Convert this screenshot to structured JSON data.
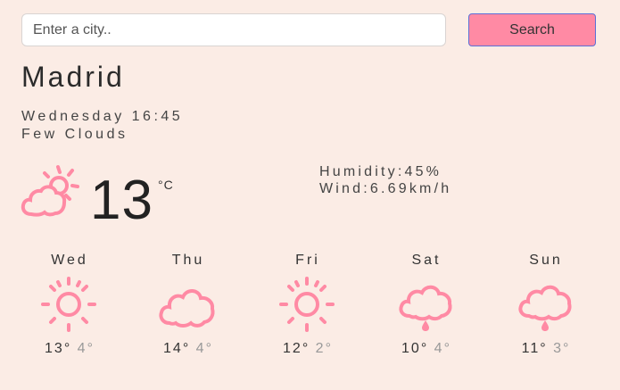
{
  "search": {
    "placeholder": "Enter a city..",
    "button_label": "Search"
  },
  "current": {
    "city": "Madrid",
    "day_time": "Wednesday 16:45",
    "condition": "Few Clouds",
    "icon": "few-clouds-icon",
    "temperature": "13",
    "unit": "°C",
    "humidity": "Humidity:45%",
    "wind": "Wind:6.69km/h"
  },
  "forecast": [
    {
      "day": "Wed",
      "icon": "sun-icon",
      "high": "13°",
      "low": "4°"
    },
    {
      "day": "Thu",
      "icon": "cloud-icon",
      "high": "14°",
      "low": "4°"
    },
    {
      "day": "Fri",
      "icon": "sun-icon",
      "high": "12°",
      "low": "2°"
    },
    {
      "day": "Sat",
      "icon": "rain-icon",
      "high": "10°",
      "low": "4°"
    },
    {
      "day": "Sun",
      "icon": "rain-icon",
      "high": "11°",
      "low": "3°"
    }
  ],
  "colors": {
    "background": "#fbece5",
    "accent": "#ff8aa4",
    "button_border": "#5b6fd6"
  }
}
